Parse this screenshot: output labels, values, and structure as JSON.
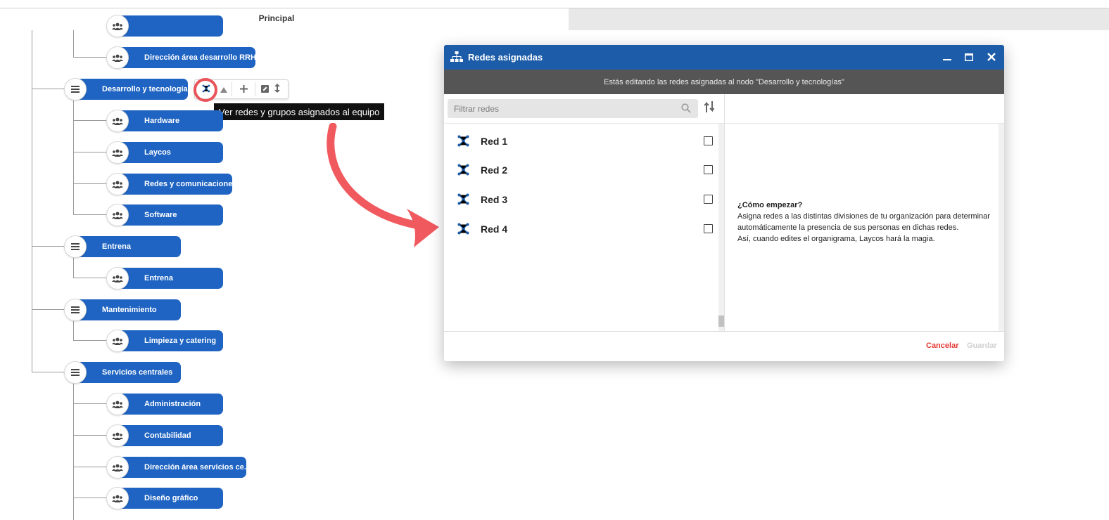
{
  "header": {
    "title": "Principal"
  },
  "tree": {
    "top_partial": "",
    "direccion_rrhh": "Dirección área desarrollo RRHH",
    "desarrollo": "Desarrollo y tecnologías",
    "hardware": "Hardware",
    "laycos": "Laycos",
    "redes": "Redes y comunicaciones",
    "software": "Software",
    "entrena_group": "Entrena",
    "entrena_team": "Entrena",
    "mantenimiento": "Mantenimiento",
    "limpieza": "Limpieza y catering",
    "servicios": "Servicios centrales",
    "administracion": "Administración",
    "contabilidad": "Contabilidad",
    "direccion_servicios": "Dirección área servicios ce...",
    "diseno": "Diseño gráfico"
  },
  "tooltip": "Ver redes y grupos asignados al equipo",
  "dialog": {
    "title": "Redes asignadas",
    "subtitle": "Estás editando las redes asignadas al nodo \"Desarrollo y tecnologías\"",
    "filter_placeholder": "Filtrar redes",
    "networks": [
      {
        "label": "Red 1",
        "checked": false
      },
      {
        "label": "Red 2",
        "checked": false
      },
      {
        "label": "Red 3",
        "checked": false
      },
      {
        "label": "Red 4",
        "checked": false
      }
    ],
    "howto_title": "¿Cómo empezar?",
    "howto_line1": "Asigna redes a las distintas divisiones de tu organización para determinar automáticamente la presencia de sus personas en dichas redes.",
    "howto_line2": "Así, cuando edites el organigrama, Laycos hará la magia.",
    "cancel_label": "Cancelar",
    "save_label": "Guardar"
  },
  "colors": {
    "node_blue": "#1f64c2",
    "title_blue": "#1c5ca8",
    "highlight_red": "#e8545a",
    "cancel_red": "#e53935"
  }
}
